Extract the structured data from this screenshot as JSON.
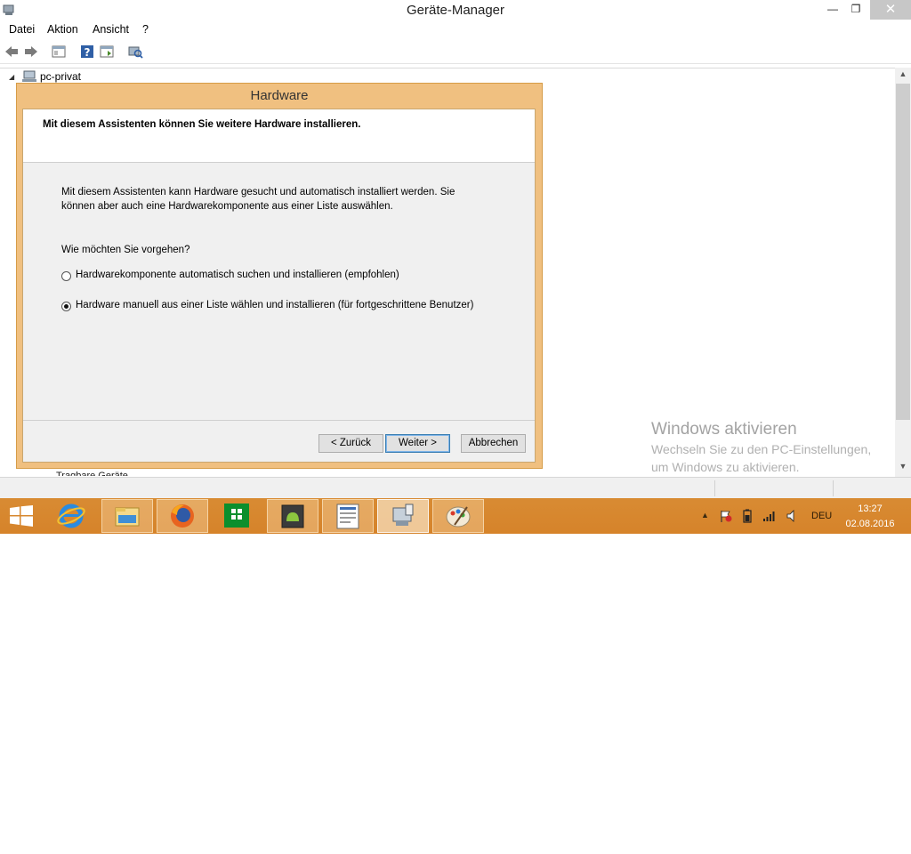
{
  "window": {
    "title": "Geräte-Manager",
    "minimize_glyph": "—",
    "restore_glyph": "❐",
    "close_glyph": "✕"
  },
  "menu": [
    "Datei",
    "Aktion",
    "Ansicht",
    "?"
  ],
  "toolbar_icons": [
    "back-arrow-icon",
    "forward-arrow-icon",
    "properties-window-icon",
    "help-icon",
    "console-tree-icon",
    "scan-hardware-icon"
  ],
  "tree": {
    "root": "pc-privat",
    "partial_item": "Tragbare Geräte"
  },
  "dialog": {
    "title": "Hardware",
    "heading": "Mit diesem Assistenten können Sie weitere Hardware installieren.",
    "description_line1": "Mit diesem Assistenten kann Hardware gesucht und automatisch installiert werden. Sie",
    "description_line2": "können aber auch eine Hardwarekomponente aus einer Liste auswählen.",
    "question": "Wie möchten Sie vorgehen?",
    "options": [
      {
        "label": "Hardwarekomponente automatisch suchen und installieren (empfohlen)",
        "selected": false
      },
      {
        "label": "Hardware manuell aus einer Liste wählen und installieren (für fortgeschrittene Benutzer)",
        "selected": true
      }
    ],
    "buttons": {
      "back": "< Zurück",
      "next": "Weiter >",
      "cancel": "Abbrechen"
    }
  },
  "watermark": {
    "title": "Windows aktivieren",
    "line1": "Wechseln Sie zu den PC-Einstellungen,",
    "line2": "um Windows zu aktivieren."
  },
  "taskbar": {
    "apps": [
      "internet-explorer-icon",
      "file-explorer-icon",
      "firefox-icon",
      "store-icon",
      "android-app-icon",
      "document-viewer-icon",
      "device-manager-icon",
      "paint-icon"
    ],
    "active_app": "device-manager-icon",
    "language": "DEU",
    "time": "13:27",
    "date": "02.08.2016"
  },
  "colors": {
    "dialog_frame": "#f0c080",
    "taskbar": "#d6832a",
    "close_button": "#c7c7c7"
  }
}
